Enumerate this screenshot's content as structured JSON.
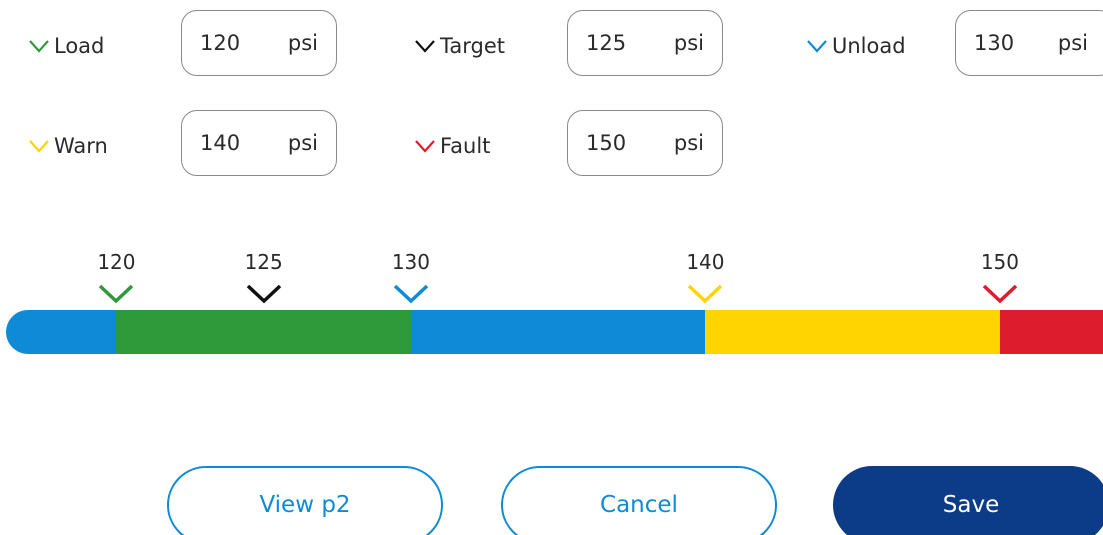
{
  "colors": {
    "load": "#2f9a3a",
    "target": "#111111",
    "unload": "#0e8ad6",
    "warn": "#ffd400",
    "fault": "#dd1c2e",
    "save_bg": "#0c3b88"
  },
  "settings": {
    "load": {
      "label": "Load",
      "value": "120",
      "unit": "psi",
      "icon": "chevron-down-icon"
    },
    "target": {
      "label": "Target",
      "value": "125",
      "unit": "psi",
      "icon": "chevron-down-icon"
    },
    "unload": {
      "label": "Unload",
      "value": "130",
      "unit": "psi",
      "icon": "chevron-down-icon"
    },
    "warn": {
      "label": "Warn",
      "value": "140",
      "unit": "psi",
      "icon": "chevron-down-icon"
    },
    "fault": {
      "label": "Fault",
      "value": "150",
      "unit": "psi",
      "icon": "chevron-down-icon"
    }
  },
  "scale": {
    "min": 116.25,
    "max": 153.5,
    "ticks": [
      "120",
      "125",
      "130",
      "140",
      "150"
    ]
  },
  "buttons": {
    "view_p2": "View p2",
    "cancel": "Cancel",
    "save": "Save"
  }
}
